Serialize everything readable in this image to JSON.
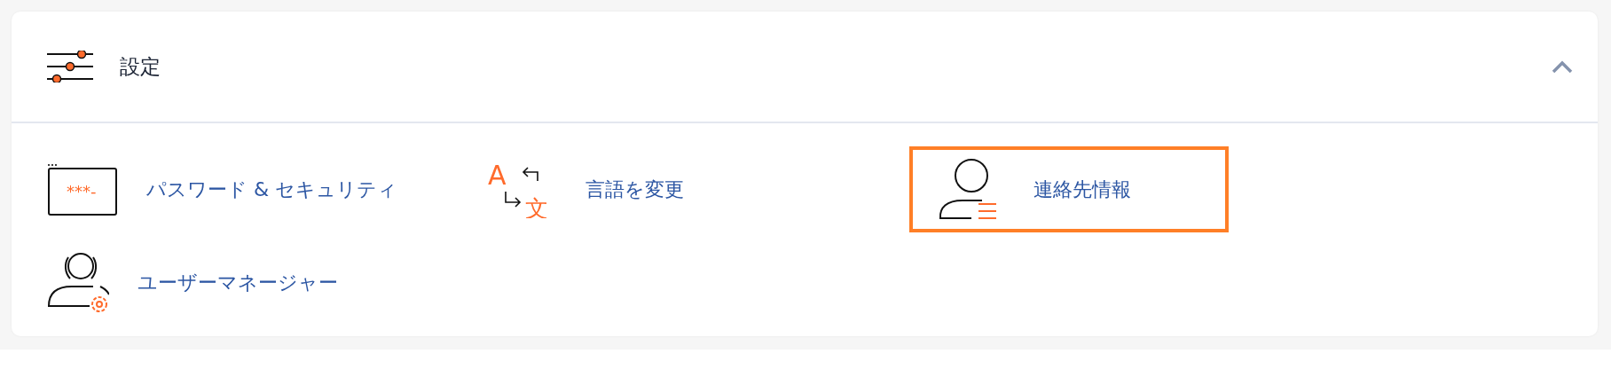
{
  "panel": {
    "title": "設定",
    "expanded": true
  },
  "items": [
    {
      "kind": "password",
      "label": "パスワード & セキュリティ",
      "icon_text": "***-",
      "selected": false
    },
    {
      "kind": "language",
      "label": "言語を変更",
      "icon_glyphs": [
        "A",
        "文"
      ],
      "selected": false
    },
    {
      "kind": "contact",
      "label": "連絡先情報",
      "selected": true
    },
    {
      "kind": "users",
      "label": "ユーザーマネージャー",
      "selected": false
    }
  ]
}
